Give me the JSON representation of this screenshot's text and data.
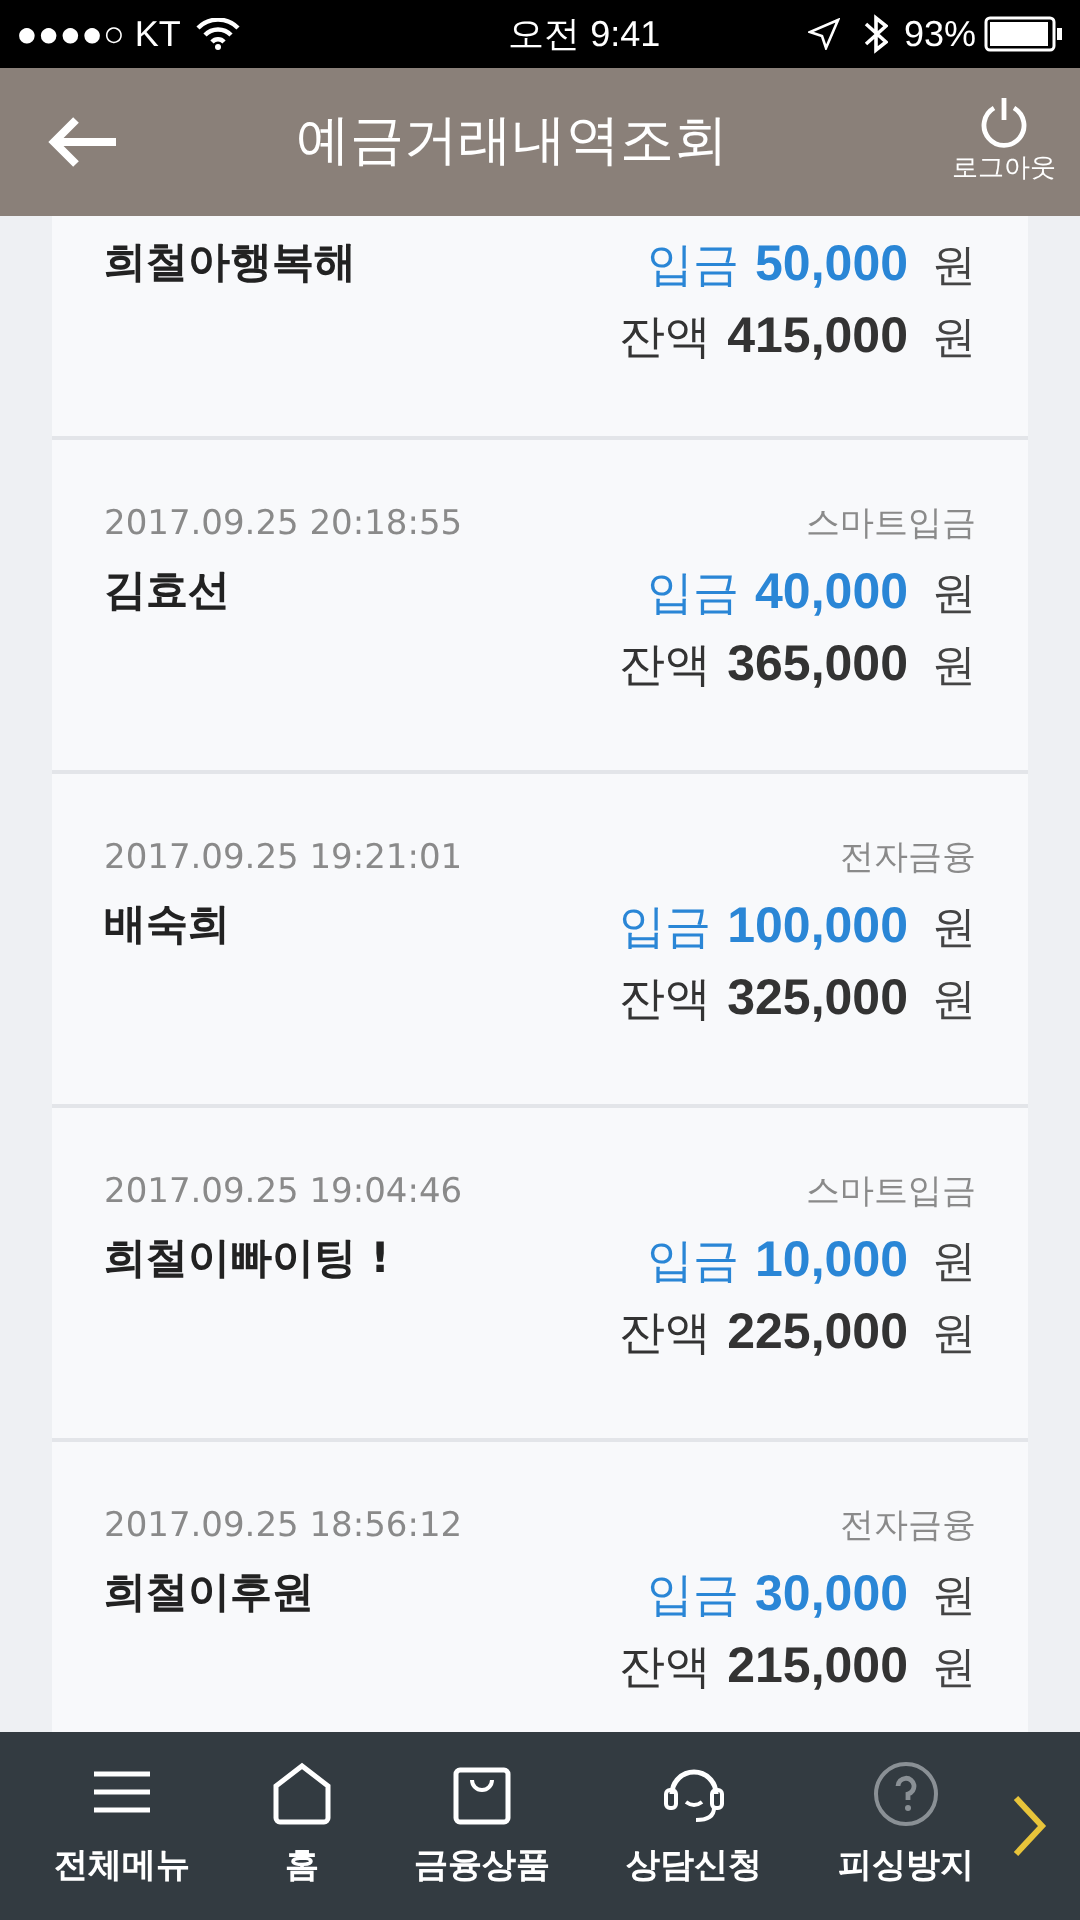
{
  "status_bar": {
    "carrier": "●●●●○ KT",
    "time": "오전 9:41",
    "battery": "93%"
  },
  "header": {
    "title": "예금거래내역조회",
    "logout": "로그아웃"
  },
  "transactions": [
    {
      "name": "희철아행복해",
      "type_label": "입금",
      "amount": "50,000",
      "unit": "원",
      "balance_label": "잔액",
      "balance": "415,000",
      "balance_unit": "원"
    },
    {
      "datetime": "2017.09.25 20:18:55",
      "channel": "스마트입금",
      "name": "김효선",
      "type_label": "입금",
      "amount": "40,000",
      "unit": "원",
      "balance_label": "잔액",
      "balance": "365,000",
      "balance_unit": "원"
    },
    {
      "datetime": "2017.09.25 19:21:01",
      "channel": "전자금융",
      "name": "배숙희",
      "type_label": "입금",
      "amount": "100,000",
      "unit": "원",
      "balance_label": "잔액",
      "balance": "325,000",
      "balance_unit": "원"
    },
    {
      "datetime": "2017.09.25 19:04:46",
      "channel": "스마트입금",
      "name": "희철이빠이팅 !",
      "type_label": "입금",
      "amount": "10,000",
      "unit": "원",
      "balance_label": "잔액",
      "balance": "225,000",
      "balance_unit": "원"
    },
    {
      "datetime": "2017.09.25 18:56:12",
      "channel": "전자금융",
      "name": "희철이후원",
      "type_label": "입금",
      "amount": "30,000",
      "unit": "원",
      "balance_label": "잔액",
      "balance": "215,000",
      "balance_unit": "원"
    }
  ],
  "bottom_nav": [
    {
      "kind": "menu",
      "label": "전체메뉴"
    },
    {
      "kind": "home",
      "label": "홈"
    },
    {
      "kind": "bag",
      "label": "금융상품"
    },
    {
      "kind": "headset",
      "label": "상담신청"
    },
    {
      "kind": "help",
      "label": "피싱방지"
    }
  ]
}
